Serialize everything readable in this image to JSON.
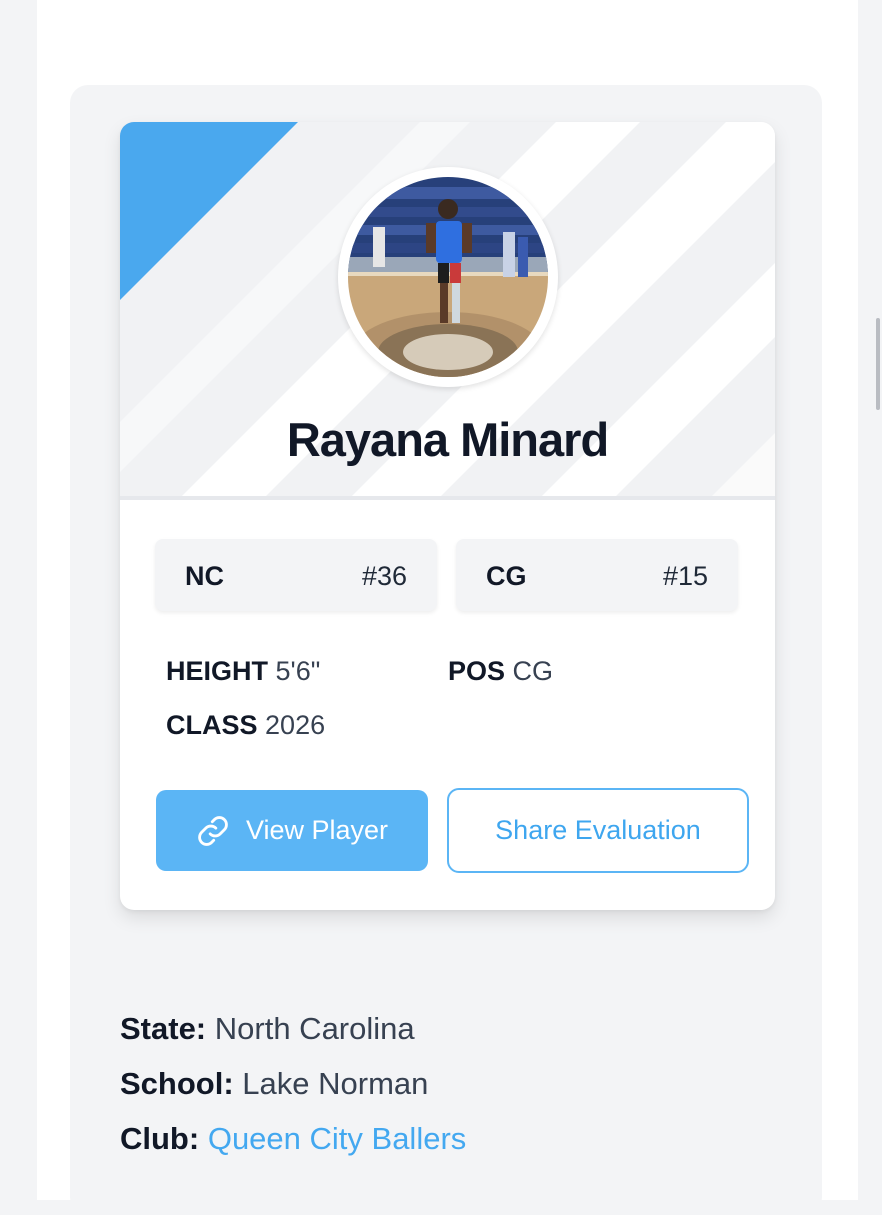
{
  "player": {
    "name": "Rayana Minard",
    "photo_alt": "Player photo on basketball court"
  },
  "rankings": [
    {
      "label": "NC",
      "value": "#36"
    },
    {
      "label": "CG",
      "value": "#15"
    }
  ],
  "stats": {
    "height_label": "HEIGHT",
    "height_value": "5'6\"",
    "pos_label": "POS",
    "pos_value": "CG",
    "class_label": "CLASS",
    "class_value": "2026"
  },
  "buttons": {
    "view_player": "View Player",
    "share_evaluation": "Share Evaluation"
  },
  "details": {
    "state_label": "State:",
    "state_value": "North Carolina",
    "school_label": "School:",
    "school_value": "Lake Norman",
    "club_label": "Club:",
    "club_value": "Queen City Ballers"
  },
  "colors": {
    "accent": "#5bb5f5",
    "link": "#43a8f0",
    "header_corner": "#4aa8ee"
  },
  "icons": {
    "view_player_icon": "link-icon"
  }
}
